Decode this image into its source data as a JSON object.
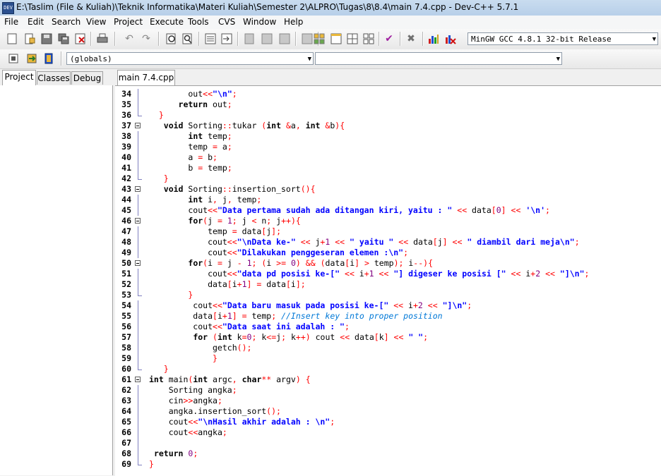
{
  "window": {
    "title": "E:\\Taslim (File & Kuliah)\\Teknik Informatika\\Materi Kuliah\\Semester 2\\ALPRO\\Tugas\\8\\8.4\\main 7.4.cpp - Dev-C++ 5.7.1",
    "icon_text": "DEV"
  },
  "menu": [
    "File",
    "Edit",
    "Search",
    "View",
    "Project",
    "Execute",
    "Tools",
    "CVS",
    "Window",
    "Help"
  ],
  "toolbar": {
    "compiler": "MinGW GCC 4.8.1 32-bit Release",
    "scope": "(globals)",
    "member": ""
  },
  "left_tabs": [
    "Project",
    "Classes",
    "Debug"
  ],
  "editor_tab": "main 7.4.cpp",
  "colors": {
    "keyword": "#000000",
    "string": "#0000ff",
    "operator": "#ff0000",
    "number": "#800080",
    "comment": "#0078d7"
  },
  "code_lines": [
    {
      "n": "34",
      "fold": "line",
      "t": "        out<<\"\\n\";"
    },
    {
      "n": "35",
      "fold": "line",
      "t": "      return out;"
    },
    {
      "n": "36",
      "fold": "end",
      "t": "  }"
    },
    {
      "n": "37",
      "fold": "open",
      "t": "   void Sorting::tukar (int &a, int &b){"
    },
    {
      "n": "38",
      "fold": "line",
      "t": "        int temp;"
    },
    {
      "n": "39",
      "fold": "line",
      "t": "        temp = a;"
    },
    {
      "n": "40",
      "fold": "line",
      "t": "        a = b;"
    },
    {
      "n": "41",
      "fold": "line",
      "t": "        b = temp;"
    },
    {
      "n": "42",
      "fold": "end",
      "t": "   }"
    },
    {
      "n": "43",
      "fold": "open",
      "t": "   void Sorting::insertion_sort(){"
    },
    {
      "n": "44",
      "fold": "line",
      "t": "        int i, j, temp;"
    },
    {
      "n": "45",
      "fold": "line",
      "t": "        cout<<\"Data pertama sudah ada ditangan kiri, yaitu : \" << data[0] << '\\n';"
    },
    {
      "n": "46",
      "fold": "open",
      "t": "        for(j = 1; j < n; j++){"
    },
    {
      "n": "47",
      "fold": "line",
      "t": "            temp = data[j];"
    },
    {
      "n": "48",
      "fold": "line",
      "t": "            cout<<\"\\nData ke-\" << j+1 << \" yaitu \" << data[j] << \" diambil dari meja\\n\";"
    },
    {
      "n": "49",
      "fold": "line",
      "t": "            cout<<\"Dilakukan penggeseran elemen :\\n\";"
    },
    {
      "n": "50",
      "fold": "open",
      "t": "        for(i = j - 1; (i >= 0) && (data[i] > temp); i--){"
    },
    {
      "n": "51",
      "fold": "line",
      "t": "            cout<<\"data pd posisi ke-[\" << i+1 << \"] digeser ke posisi [\" << i+2 << \"]\\n\";"
    },
    {
      "n": "52",
      "fold": "line",
      "t": "            data[i+1] = data[i];"
    },
    {
      "n": "53",
      "fold": "end",
      "t": "        }"
    },
    {
      "n": "54",
      "fold": "line",
      "t": "         cout<<\"Data baru masuk pada posisi ke-[\" << i+2 << \"]\\n\";"
    },
    {
      "n": "55",
      "fold": "line",
      "t": "         data[i+1] = temp; //Insert key into proper position"
    },
    {
      "n": "56",
      "fold": "line",
      "t": "         cout<<\"Data saat ini adalah : \";"
    },
    {
      "n": "57",
      "fold": "line",
      "t": "         for (int k=0; k<=j; k++) cout << data[k] << \" \";"
    },
    {
      "n": "58",
      "fold": "line",
      "t": "             getch();"
    },
    {
      "n": "59",
      "fold": "line",
      "t": "             }"
    },
    {
      "n": "60",
      "fold": "end",
      "t": "   }"
    },
    {
      "n": "61",
      "fold": "open",
      "t": "int main(int argc, char** argv) {"
    },
    {
      "n": "62",
      "fold": "line",
      "t": "    Sorting angka;"
    },
    {
      "n": "63",
      "fold": "line",
      "t": "    cin>>angka;"
    },
    {
      "n": "64",
      "fold": "line",
      "t": "    angka.insertion_sort();"
    },
    {
      "n": "65",
      "fold": "line",
      "t": "    cout<<\"\\nHasil akhir adalah : \\n\";"
    },
    {
      "n": "66",
      "fold": "line",
      "t": "    cout<<angka;"
    },
    {
      "n": "67",
      "fold": "line",
      "t": ""
    },
    {
      "n": "68",
      "fold": "line",
      "t": " return 0;"
    },
    {
      "n": "69",
      "fold": "end",
      "t": "}"
    }
  ]
}
